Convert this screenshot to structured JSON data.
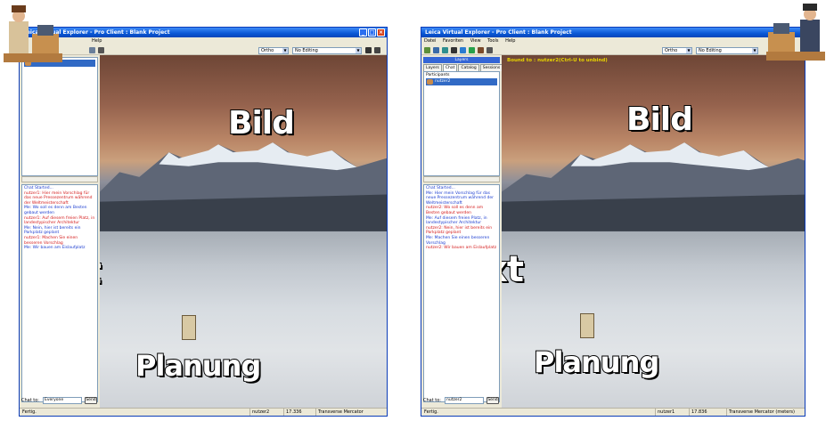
{
  "left": {
    "title": "Leica Virtual Explorer - Pro Client : Blank Project",
    "menu": [
      "Help"
    ],
    "projection": "Ortho",
    "editing": "No Editing",
    "chat_lines": [
      {
        "cls": "me",
        "text": "Chat Started..."
      },
      {
        "cls": "other",
        "text": "nutzer1: Hier mein Vorschlag für das neue Pressezentrum während der Weltmeisterschaft"
      },
      {
        "cls": "me",
        "text": "Me: Wo soll es denn am Besten gebaut werden"
      },
      {
        "cls": "other",
        "text": "nutzer1: Auf diesem freien Platz, in landestypischer Architektur"
      },
      {
        "cls": "me",
        "text": "Me: Nein, hier ist bereits ein Parkplatz geplant"
      },
      {
        "cls": "other",
        "text": "nutzer1: Machen Sie einen besseren Vorschlag"
      },
      {
        "cls": "me",
        "text": "Me: Wir bauen am Eislaufplatz"
      }
    ],
    "chat_to_label": "Chat to:",
    "chat_to_value": "Everyone",
    "send": "Send",
    "status": {
      "ready": "Fertig.",
      "user": "nutzer2",
      "zoom": "17.336",
      "proj": "Transverse Mercator (meters)"
    }
  },
  "right": {
    "title": "Leica Virtual Explorer - Pro Client : Blank Project",
    "menu": [
      "Datei",
      "Favoriten",
      "View",
      "Tools",
      "Help"
    ],
    "projection": "Ortho",
    "editing": "No Editing",
    "layers": "Layers",
    "tabs": [
      "Layers",
      "Chat",
      "Catalog",
      "Sessions"
    ],
    "participants_header": "Participants",
    "participant": "nutzer2",
    "bound_to": "Bound to : nutzer2(Ctrl-U to unbind)",
    "chat_lines": [
      {
        "cls": "me",
        "text": "Chat Started..."
      },
      {
        "cls": "me",
        "text": "Me: Hier mein Vorschlag für das neue Pressezentrum während der Weltmeisterschaft"
      },
      {
        "cls": "other",
        "text": "nutzer2: Wo soll es denn am Besten gebaut werden"
      },
      {
        "cls": "me",
        "text": "Me: Auf diesem freien Platz, in landestypischer Architektur"
      },
      {
        "cls": "other",
        "text": "nutzer2: Nein, hier ist bereits ein Parkplatz geplant"
      },
      {
        "cls": "me",
        "text": "Me: Machen Sie einen besseren Vorschlag"
      },
      {
        "cls": "other",
        "text": "nutzer2: Wir bauen am Eislaufplatz"
      }
    ],
    "chat_to_label": "Chat to:",
    "chat_to_value": "nutzer2",
    "send": "Send",
    "status": {
      "ready": "Fertig.",
      "user": "nutzer1",
      "zoom": "17.836",
      "proj": "Transverse Mercator (meters)"
    }
  },
  "overlays": {
    "bild": "Bild",
    "text": "Text",
    "planung": "Planung"
  },
  "colors": {
    "title_blue": "#0a58d6",
    "me": "#1a3cd0",
    "other": "#d41a1a",
    "selection": "#316ac5"
  }
}
